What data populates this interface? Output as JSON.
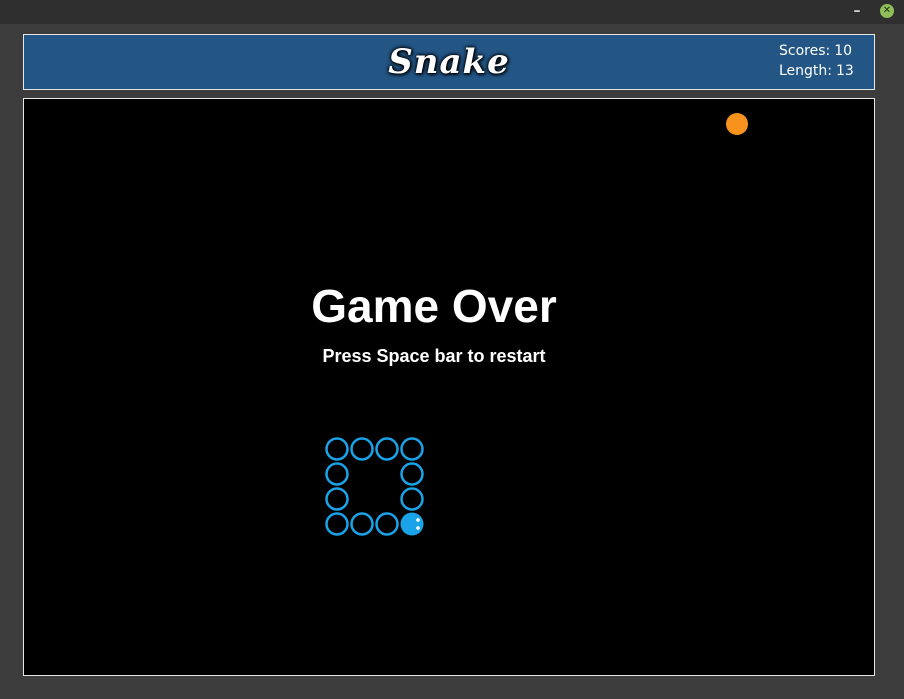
{
  "window": {
    "minimize_glyph": "–",
    "close_glyph": "✕"
  },
  "header": {
    "logo": "Snake",
    "scores_label": "Scores:",
    "scores": 10,
    "length_label": "Length:",
    "length": 13
  },
  "game": {
    "title": "Game Over",
    "instruction": "Press Space bar to restart",
    "grid_columns": 34,
    "grid_rows": 23,
    "snake": [
      [
        12,
        17
      ],
      [
        13,
        17
      ],
      [
        14,
        17
      ],
      [
        15,
        17
      ],
      [
        15,
        16
      ],
      [
        15,
        15
      ],
      [
        15,
        14
      ],
      [
        14,
        14
      ],
      [
        13,
        14
      ],
      [
        12,
        14
      ],
      [
        12,
        15
      ],
      [
        12,
        16
      ],
      [
        15,
        17
      ]
    ],
    "head": [
      15,
      17
    ],
    "food": [
      28,
      1
    ]
  },
  "colors": {
    "snake": "#1aa3e8",
    "food": "#f7921e",
    "header_bg": "#235585",
    "board_bg": "#000000"
  }
}
